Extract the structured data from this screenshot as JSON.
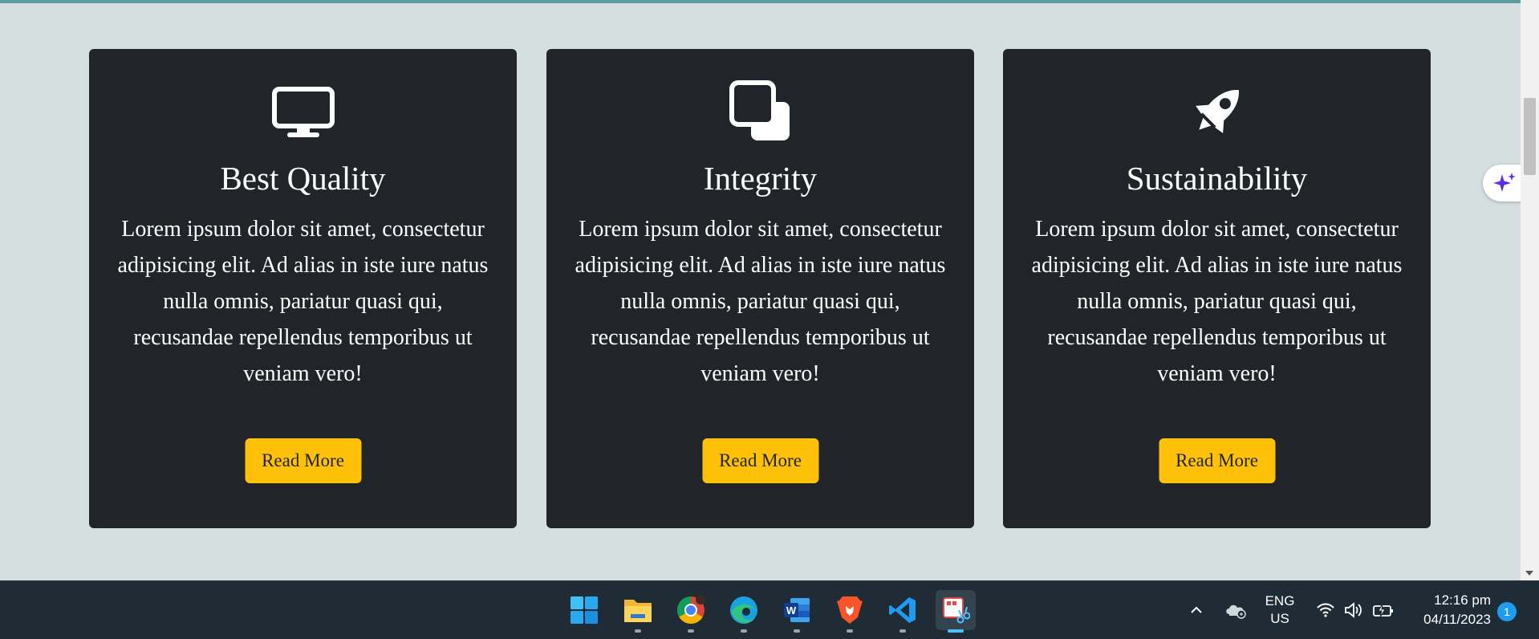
{
  "cards": [
    {
      "icon": "monitor-icon",
      "title": "Best Quality",
      "text": "Lorem ipsum dolor sit amet, consectetur adipisicing elit. Ad alias in iste iure natus nulla omnis, pariatur quasi qui, recusandae repellendus temporibus ut veniam vero!",
      "button": "Read More"
    },
    {
      "icon": "copy-squares-icon",
      "title": "Integrity",
      "text": "Lorem ipsum dolor sit amet, consectetur adipisicing elit. Ad alias in iste iure natus nulla omnis, pariatur quasi qui, recusandae repellendus temporibus ut veniam vero!",
      "button": "Read More"
    },
    {
      "icon": "rocket-icon",
      "title": "Sustainability",
      "text": "Lorem ipsum dolor sit amet, consectetur adipisicing elit. Ad alias in iste iure natus nulla omnis, pariatur quasi qui, recusandae repellendus temporibus ut veniam vero!",
      "button": "Read More"
    }
  ],
  "colors": {
    "page_bg": "#d5dfe0",
    "card_bg": "#212529",
    "button_bg": "#ffc107",
    "accent_bar": "#5f9ea0",
    "taskbar_bg": "#1f2c35"
  },
  "taskbar": {
    "apps": [
      {
        "name": "windows-start-icon"
      },
      {
        "name": "file-explorer-icon"
      },
      {
        "name": "chrome-icon"
      },
      {
        "name": "edge-icon"
      },
      {
        "name": "word-icon"
      },
      {
        "name": "brave-icon"
      },
      {
        "name": "vscode-icon"
      },
      {
        "name": "snipping-tool-icon",
        "active": true
      }
    ],
    "language_line1": "ENG",
    "language_line2": "US",
    "time": "12:16 pm",
    "date": "04/11/2023",
    "notification_count": "1"
  }
}
